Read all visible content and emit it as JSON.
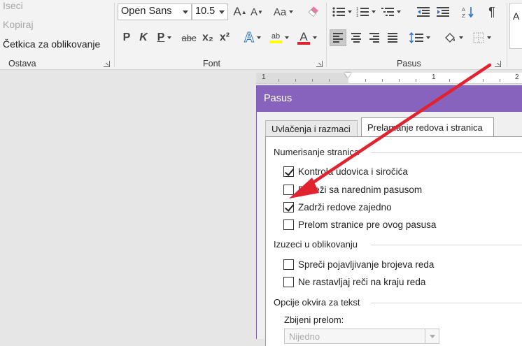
{
  "ribbon": {
    "clipboard": {
      "cut": "Iseci",
      "copy": "Kopiraj",
      "format_painter": "Četkica za oblikovanje",
      "label": "Ostava"
    },
    "font": {
      "font_name": "Open Sans",
      "font_size": "10.5",
      "grow": "A",
      "shrink": "A",
      "change_case": "Aa",
      "bold": "P",
      "italic": "K",
      "underline": "P",
      "strike": "abc",
      "subscript": "x₂",
      "superscript": "x²",
      "text_effects": "A",
      "highlight": "ab",
      "font_color": "A",
      "label": "Font"
    },
    "paragraph": {
      "pilcrow": "¶",
      "label": "Pasus"
    },
    "styles_peek": "A"
  },
  "ruler": {
    "marks": [
      "1",
      "1",
      "2"
    ]
  },
  "dialog": {
    "title": "Pasus",
    "tabs": [
      {
        "label": "Uvlačenja i razmaci",
        "active": false
      },
      {
        "label": "Prelamanje redova i stranica",
        "active": true
      }
    ],
    "sections": {
      "pagination": {
        "title": "Numerisanje stranica",
        "options": [
          {
            "label": "Kontrola udovica i siročića",
            "checked": true
          },
          {
            "label": "Poveži sa narednim pasusom",
            "checked": false
          },
          {
            "label": "Zadrži redove zajedno",
            "checked": true
          },
          {
            "label": "Prelom stranice pre ovog pasusa",
            "checked": false
          }
        ]
      },
      "formatting_exceptions": {
        "title": "Izuzeci u oblikovanju",
        "options": [
          {
            "label": "Spreči pojavljivanje brojeva reda",
            "checked": false
          },
          {
            "label": "Ne rastavljaj reči na kraju reda",
            "checked": false
          }
        ]
      },
      "textbox": {
        "title": "Opcije okvira za tekst",
        "tight_wrap_label": "Zbijeni prelom:",
        "tight_wrap_value": "Nijedno"
      }
    }
  },
  "colors": {
    "dialog_titlebar": "#8763be",
    "annotation_arrow": "#e0232e",
    "highlight_yellow": "#ffff00",
    "font_color_red": "#e0232e"
  }
}
